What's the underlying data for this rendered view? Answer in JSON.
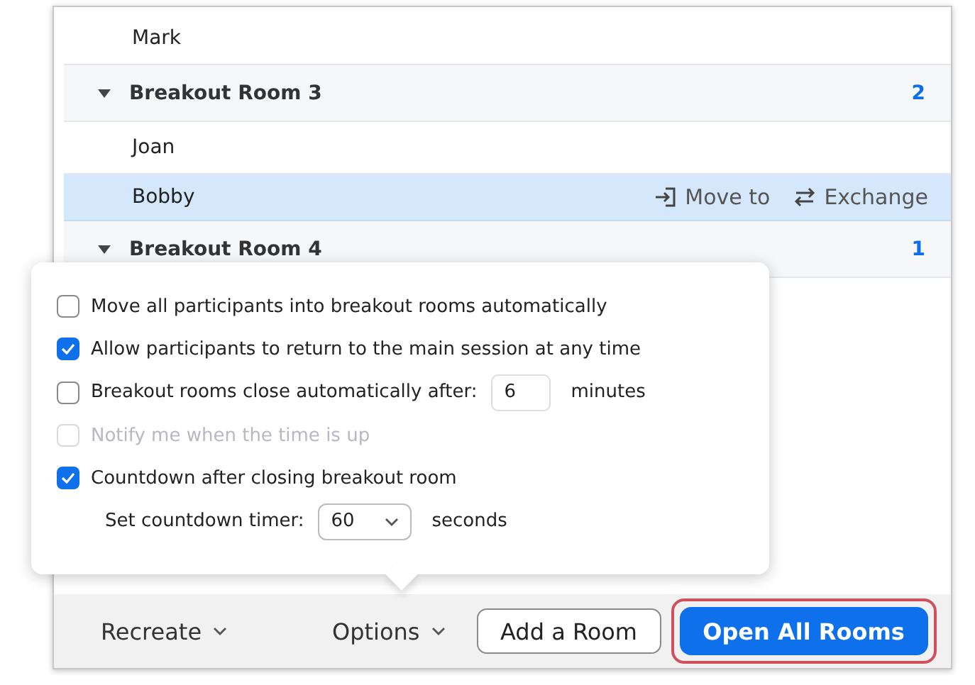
{
  "rows": [
    {
      "kind": "participant",
      "name": "Mark",
      "selected": false
    },
    {
      "kind": "room",
      "name": "Breakout Room 3",
      "count": "2",
      "expanded": true
    },
    {
      "kind": "participant",
      "name": "Joan",
      "selected": false
    },
    {
      "kind": "participant",
      "name": "Bobby",
      "selected": true,
      "actions": [
        {
          "kind": "move",
          "label": "Move to"
        },
        {
          "kind": "exchange",
          "label": "Exchange"
        }
      ]
    },
    {
      "kind": "room",
      "name": "Breakout Room 4",
      "count": "1",
      "expanded": true
    }
  ],
  "options": [
    {
      "kind": "checkbox",
      "label": "Move all participants into breakout rooms automatically",
      "checked": false,
      "disabled": false
    },
    {
      "kind": "checkbox",
      "label": "Allow participants to return to the main session at any time",
      "checked": true,
      "disabled": false
    },
    {
      "kind": "checkbox",
      "label": "Breakout rooms close automatically after:",
      "checked": false,
      "disabled": false,
      "value": "6",
      "suffix": "minutes"
    },
    {
      "kind": "checkbox",
      "label": "Notify me when the time is up",
      "checked": false,
      "disabled": true
    },
    {
      "kind": "checkbox",
      "label": "Countdown after closing breakout room",
      "checked": true,
      "disabled": false
    },
    {
      "kind": "select",
      "label": "Set countdown timer:",
      "value": "60",
      "suffix": "seconds"
    }
  ],
  "footer": {
    "recreate": "Recreate",
    "options": "Options",
    "add_room": "Add a Room",
    "open_all": "Open All Rooms",
    "open_all_highlighted": true
  }
}
